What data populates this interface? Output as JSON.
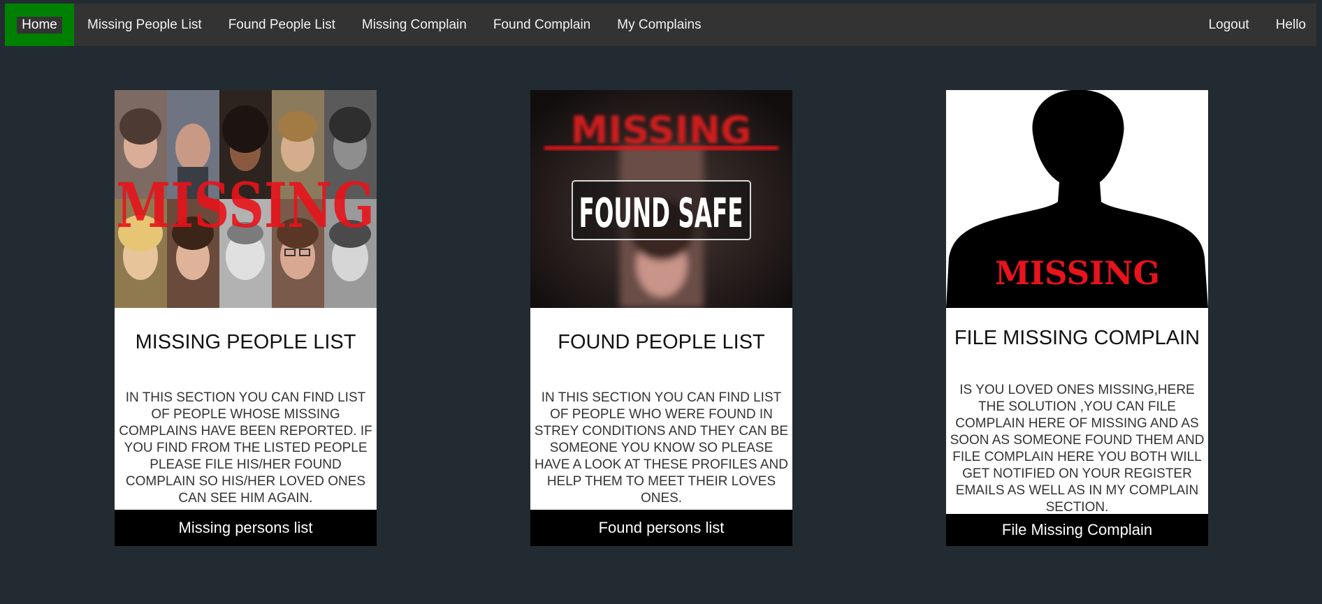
{
  "navbar": {
    "home_label": "Home",
    "items": [
      {
        "label": "Missing People List"
      },
      {
        "label": "Found People List"
      },
      {
        "label": "Missing Complain"
      },
      {
        "label": "Found Complain"
      },
      {
        "label": "My Complains"
      }
    ],
    "logout_label": "Logout",
    "hello_label": "Hello"
  },
  "cards": [
    {
      "image_text": "MISSING",
      "title": "MISSING PEOPLE LIST",
      "description": "IN THIS SECTION YOU CAN FIND LIST OF PEOPLE WHOSE MISSING COMPLAINS HAVE BEEN REPORTED. IF YOU FIND FROM THE LISTED PEOPLE PLEASE FILE HIS/HER FOUND COMPLAIN SO HIS/HER LOVED ONES CAN SEE HIM AGAIN.",
      "button_label": "Missing persons list"
    },
    {
      "image_text_top": "MISSING",
      "image_text": "FOUND SAFE",
      "title": "FOUND PEOPLE LIST",
      "description": "IN THIS SECTION YOU CAN FIND LIST OF PEOPLE WHO WERE FOUND IN STREY CONDITIONS AND THEY CAN BE SOMEONE YOU KNOW SO PLEASE HAVE A LOOK AT THESE PROFILES AND HELP THEM TO MEET THEIR LOVES ONES.",
      "button_label": "Found persons list"
    },
    {
      "image_text": "MISSING",
      "title": "FILE MISSING COMPLAIN",
      "description": "IS YOU LOVED ONES MISSING,HERE THE SOLUTION ,YOU CAN FILE COMPLAIN HERE OF MISSING AND AS SOON AS SOMEONE FOUND THEM AND FILE COMPLAIN HERE YOU BOTH WILL GET NOTIFIED ON YOUR REGISTER EMAILS AS WELL AS IN MY COMPLAIN SECTION.",
      "button_label": "File Missing Complain"
    }
  ],
  "colors": {
    "page_background": "#222b31",
    "navbar_background": "#333333",
    "home_active": "#008000",
    "missing_red": "#e8131b",
    "card_background": "#ffffff",
    "button_background": "#000000"
  }
}
